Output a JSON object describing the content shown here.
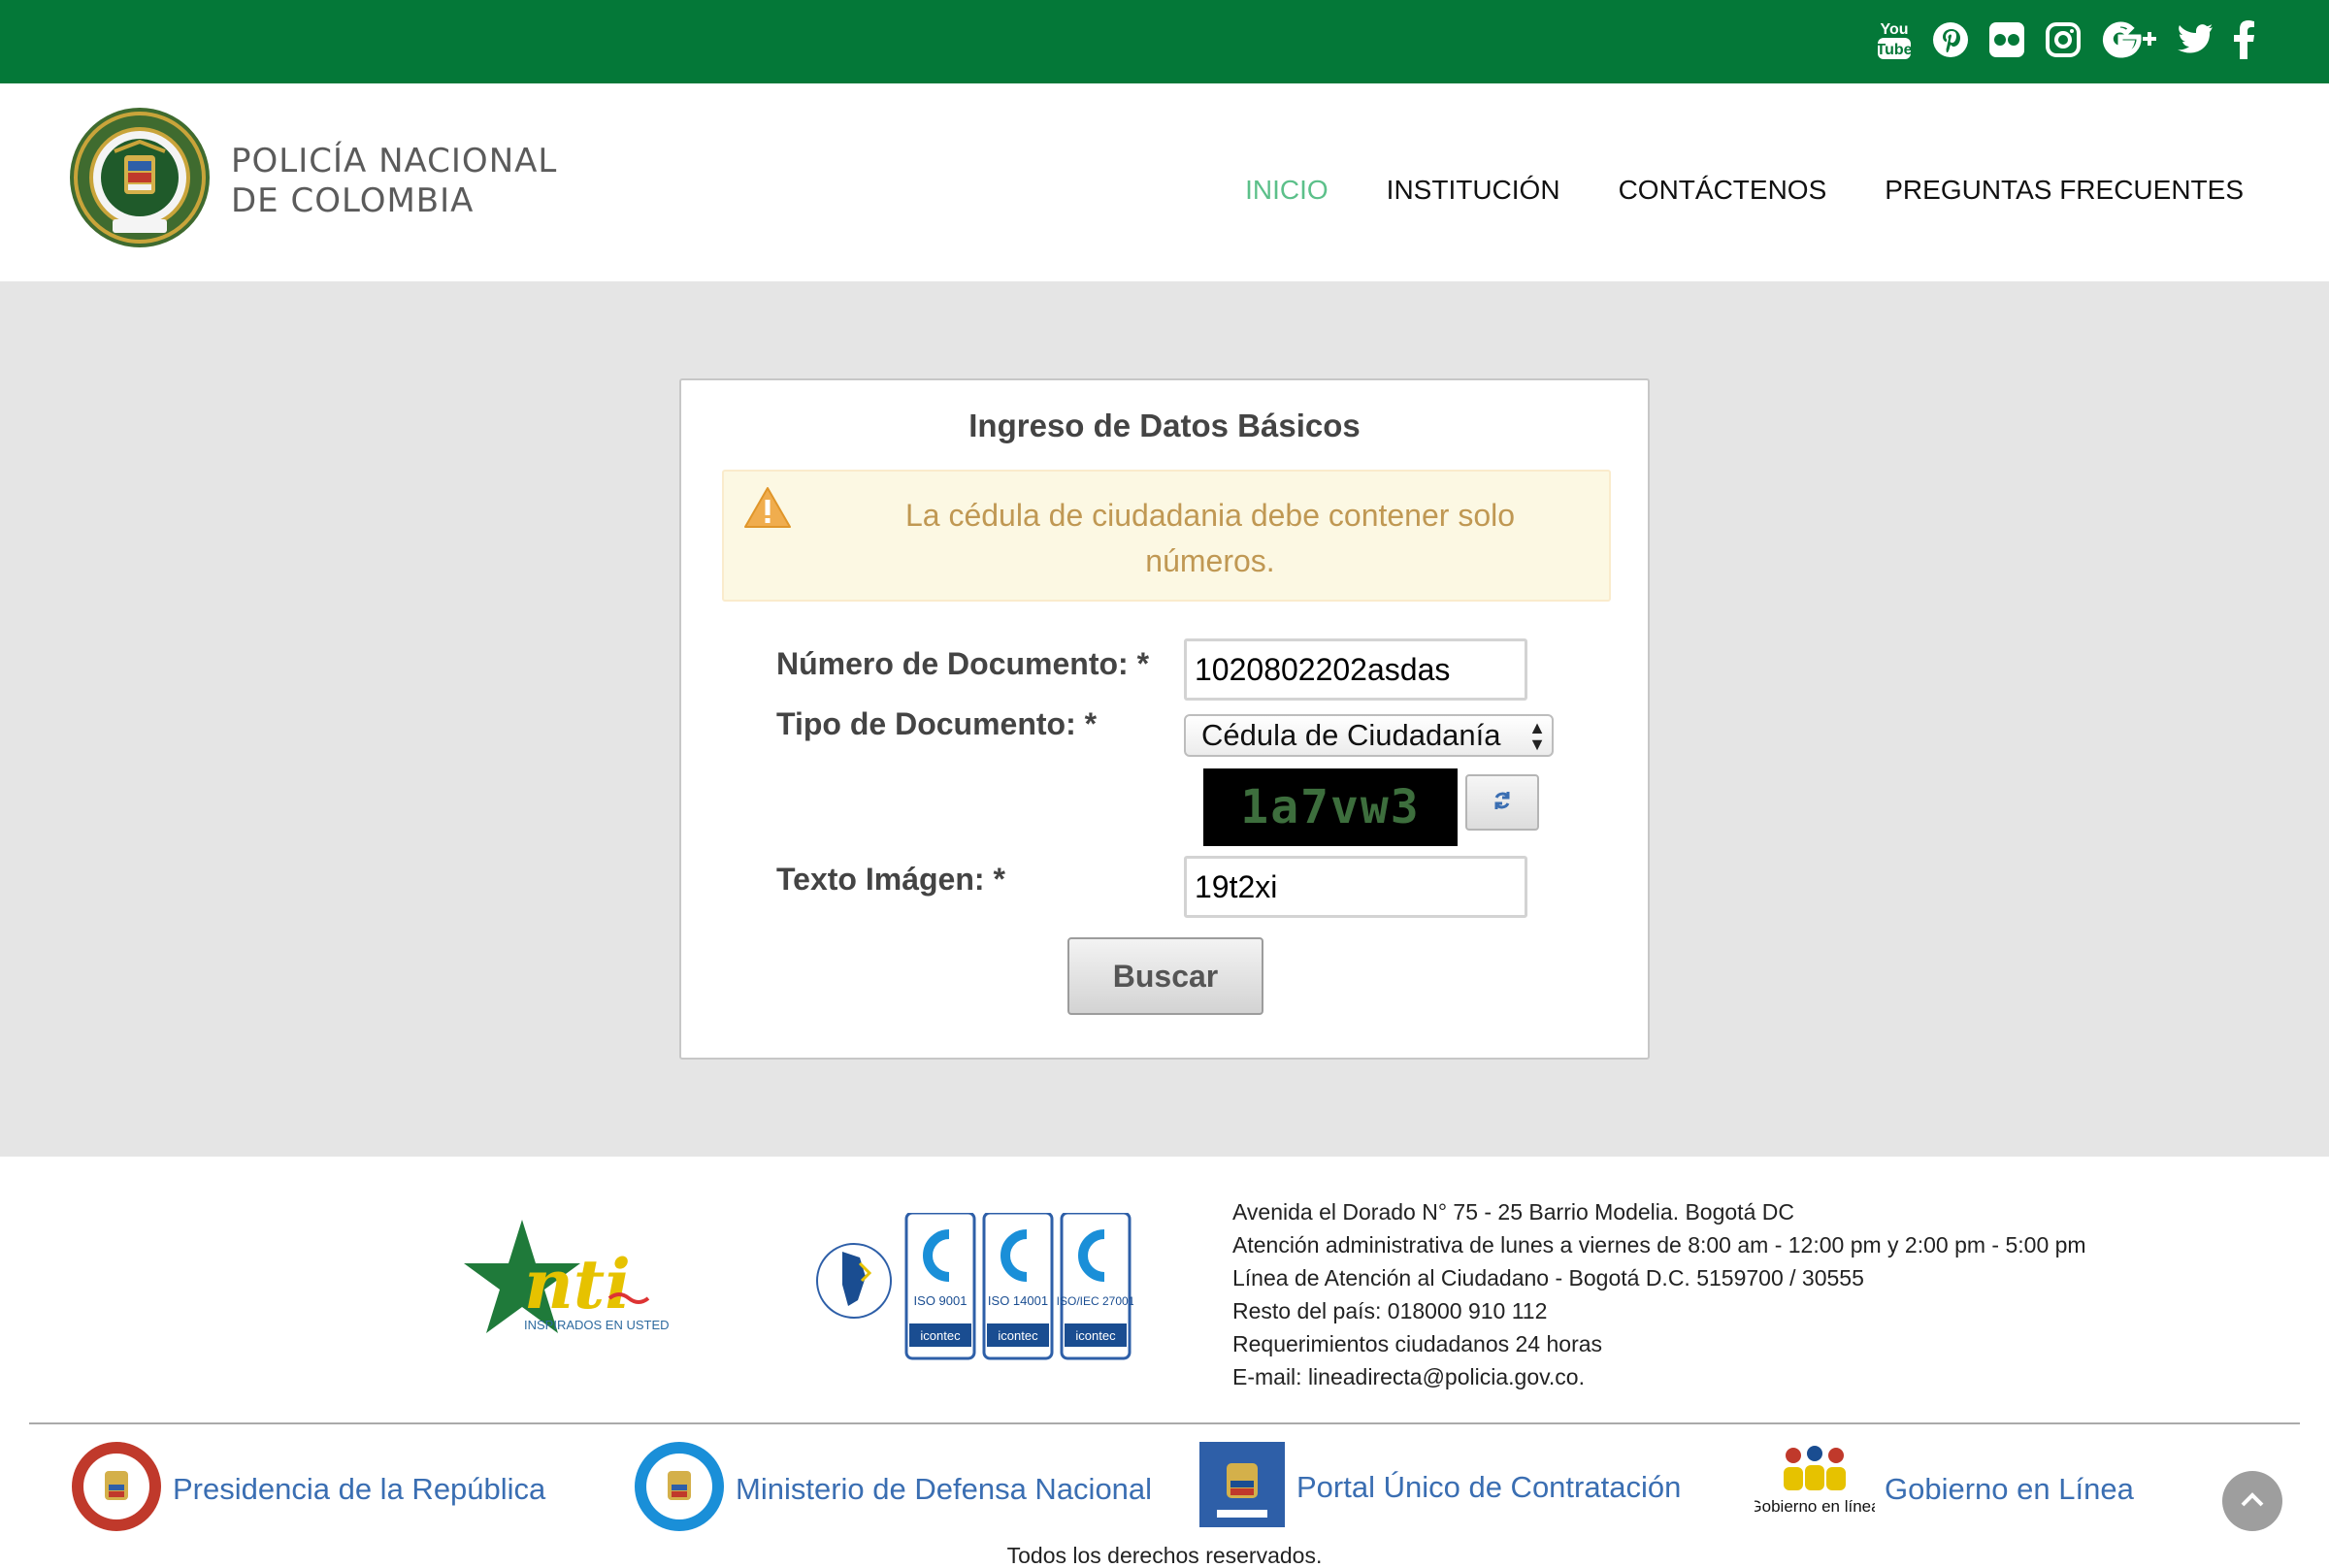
{
  "social": {
    "icons": [
      "youtube-icon",
      "pinterest-icon",
      "flickr-icon",
      "instagram-icon",
      "google-plus-icon",
      "twitter-icon",
      "facebook-icon"
    ],
    "youtube_text_top": "You",
    "youtube_text_bottom": "Tube"
  },
  "header": {
    "brand_line1": "POLICÍA NACIONAL",
    "brand_line2": "DE COLOMBIA",
    "nav": [
      "INICIO",
      "INSTITUCIÓN",
      "CONTÁCTENOS",
      "PREGUNTAS FRECUENTES"
    ],
    "active_nav": "INICIO"
  },
  "form": {
    "title": "Ingreso de Datos Básicos",
    "alert_message": "La cédula de ciudadania debe contener solo números.",
    "doc_number_label": "Número de Documento: *",
    "doc_number_value": "1020802202asdas",
    "doc_type_label": "Tipo de Documento: *",
    "doc_type_value": "Cédula de Ciudadanía",
    "captcha_text": "1a7vw3",
    "captcha_label": "Texto Imágen: *",
    "captcha_value": "19t2xi",
    "submit_label": "Buscar"
  },
  "footer": {
    "mintic_tagline": "INSPIRADOS EN USTED",
    "certs": [
      "ISO 9001",
      "ISO 14001",
      "ISO/IEC 27001"
    ],
    "cert_brand": "icontec",
    "address_lines": [
      "Avenida el Dorado N° 75 - 25 Barrio Modelia. Bogotá DC",
      "Atención administrativa de lunes a viernes de 8:00 am - 12:00 pm y 2:00 pm - 5:00 pm",
      "Línea de Atención al Ciudadano - Bogotá D.C. 5159700 / 30555",
      "Resto del país: 018000 910 112",
      "Requerimientos ciudadanos 24 horas",
      "E-mail: lineadirecta@policia.gov.co."
    ],
    "links": [
      "Presidencia de la República",
      "Ministerio de Defensa Nacional",
      "Portal Único de Contratación",
      "Gobierno en Línea"
    ],
    "gel_logo_text": "Gobierno en línea",
    "copyright": "Todos los derechos reservados."
  },
  "colors": {
    "topbar": "#047838",
    "nav_active": "#5cc08a",
    "alert_text": "#c09853",
    "alert_bg": "#fcf8e3",
    "link": "#3a6eb2"
  }
}
